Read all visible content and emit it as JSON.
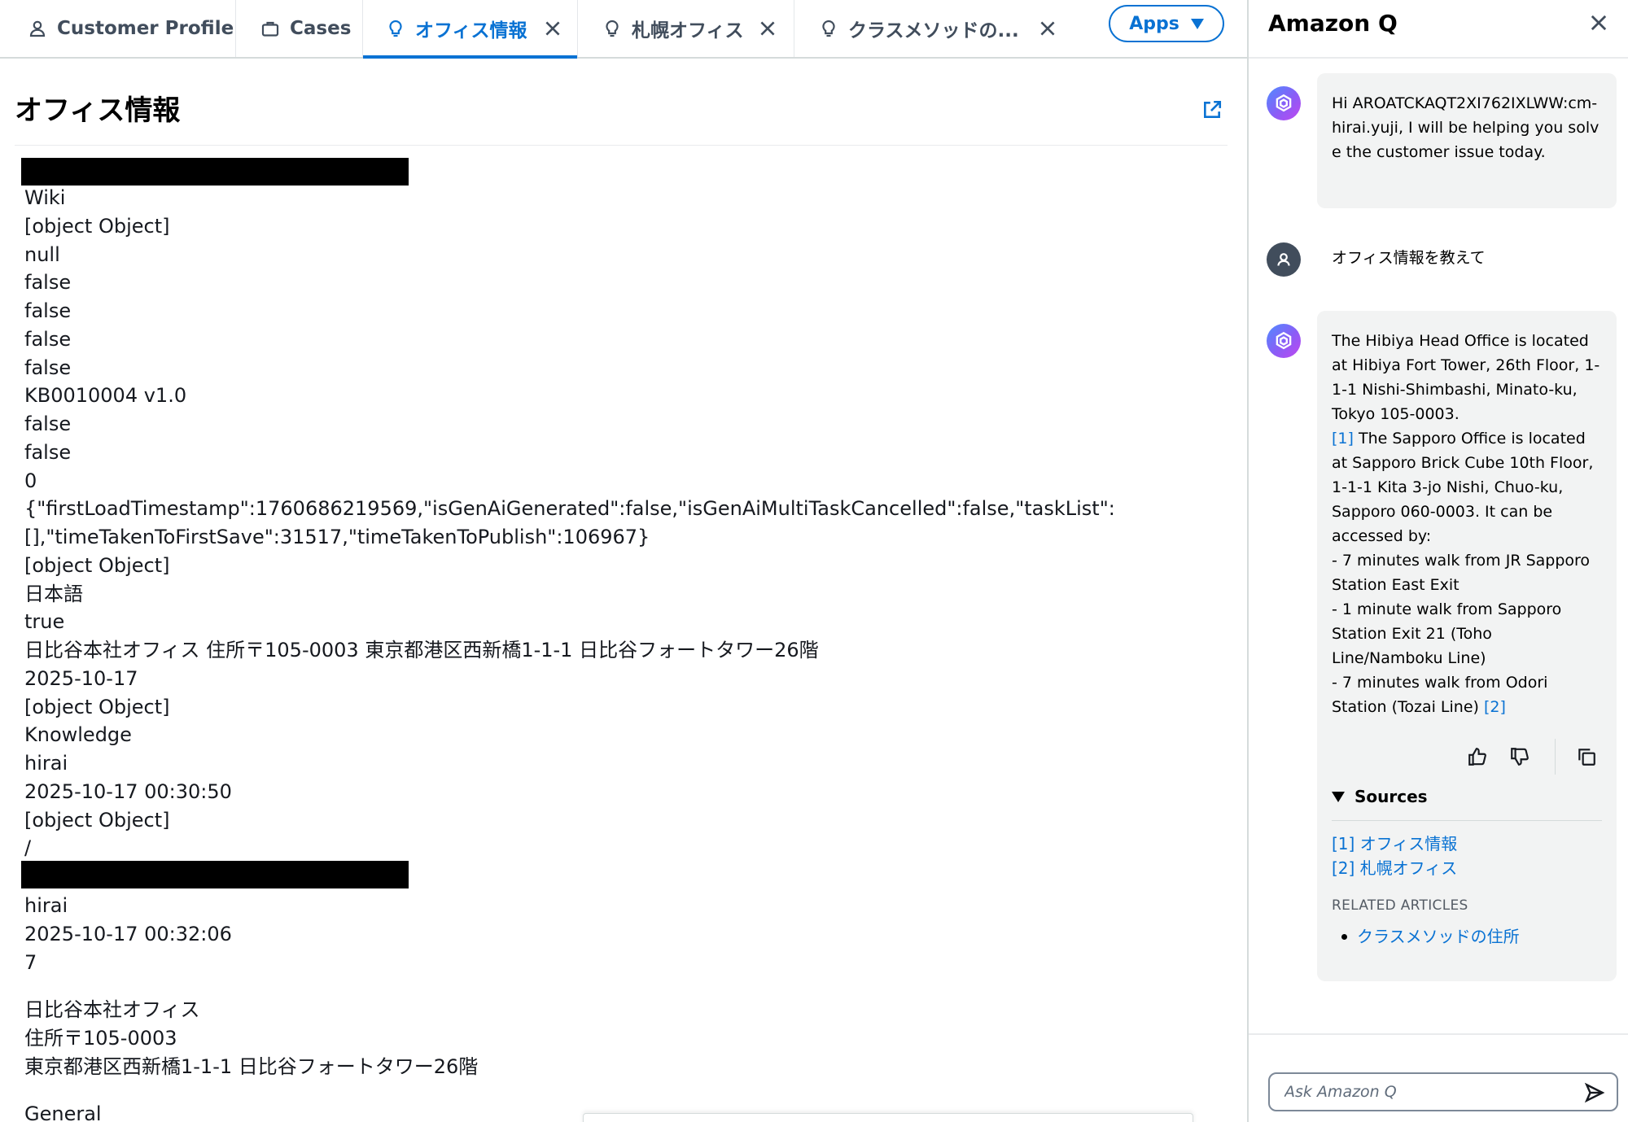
{
  "tabs": [
    {
      "label": "Customer Profile",
      "icon": "user-icon",
      "closable": false,
      "active": false
    },
    {
      "label": "Cases",
      "icon": "briefcase-icon",
      "closable": false,
      "active": false
    },
    {
      "label": "オフィス情報",
      "icon": "lightbulb-icon",
      "closable": true,
      "active": true
    },
    {
      "label": "札幌オフィス",
      "icon": "lightbulb-icon",
      "closable": true,
      "active": false
    },
    {
      "label": "クラスメソッドの...",
      "icon": "lightbulb-icon",
      "closable": true,
      "active": false
    }
  ],
  "apps_button": {
    "label": "Apps"
  },
  "article": {
    "title": "オフィス情報",
    "lines_a": [
      "Wiki",
      "[object Object]",
      "null",
      "false",
      "false",
      "false",
      "false",
      "KB0010004 v1.0",
      "false",
      "false",
      "0",
      "{\"firstLoadTimestamp\":1760686219569,\"isGenAiGenerated\":false,\"isGenAiMultiTaskCancelled\":false,\"taskList\":",
      "[],\"timeTakenToFirstSave\":31517,\"timeTakenToPublish\":106967}",
      "[object Object]",
      "日本語",
      "true",
      "日比谷本社オフィス 住所〒105-0003 東京都港区西新橋1-1-1 日比谷フォートタワー26階",
      "2025-10-17",
      "[object Object]",
      "Knowledge",
      "hirai",
      "2025-10-17 00:30:50",
      "[object Object]",
      "/"
    ],
    "lines_b": [
      "hirai",
      "2025-10-17 00:32:06",
      "7"
    ],
    "lines_c": [
      "日比谷本社オフィス",
      "住所〒105-0003",
      "東京都港区西新橋1-1-1 日比谷フォートタワー26階"
    ],
    "lines_d": [
      "General"
    ]
  },
  "amazon_q": {
    "title": "Amazon Q",
    "greeting": "Hi AROATCKAQT2XI762IXLWW:cm-hirai.yuji, I will be helping you solve the customer issue today.",
    "user_message": "オフィス情報を教えて",
    "answer": {
      "part1": "The Hibiya Head Office is located at Hibiya Fort Tower, 26th Floor, 1-1-1 Nishi-Shimbashi, Minato-ku, Tokyo 105-0003.",
      "cite1": "[1]",
      "part2": "The Sapporo Office is located at Sapporo Brick Cube 10th Floor, 1-1-1 Kita 3-jo Nishi, Chuo-ku, Sapporo 060-0003. It can be accessed by:",
      "bullet1": "- 7 minutes walk from JR Sapporo Station East Exit",
      "bullet2": "- 1 minute walk from Sapporo Station Exit 21 (Toho Line/Namboku Line)",
      "bullet3": "- 7 minutes walk from Odori Station (Tozai Line)",
      "cite2": "[2]"
    },
    "sources_label": "Sources",
    "sources": [
      "[1] オフィス情報",
      "[2] 札幌オフィス"
    ],
    "related_label": "RELATED ARTICLES",
    "related": [
      "クラスメソッドの住所"
    ],
    "input_placeholder": "Ask Amazon Q"
  },
  "colors": {
    "accent": "#0972d3",
    "text": "#16191f",
    "bubble_bg": "#f2f3f3"
  }
}
